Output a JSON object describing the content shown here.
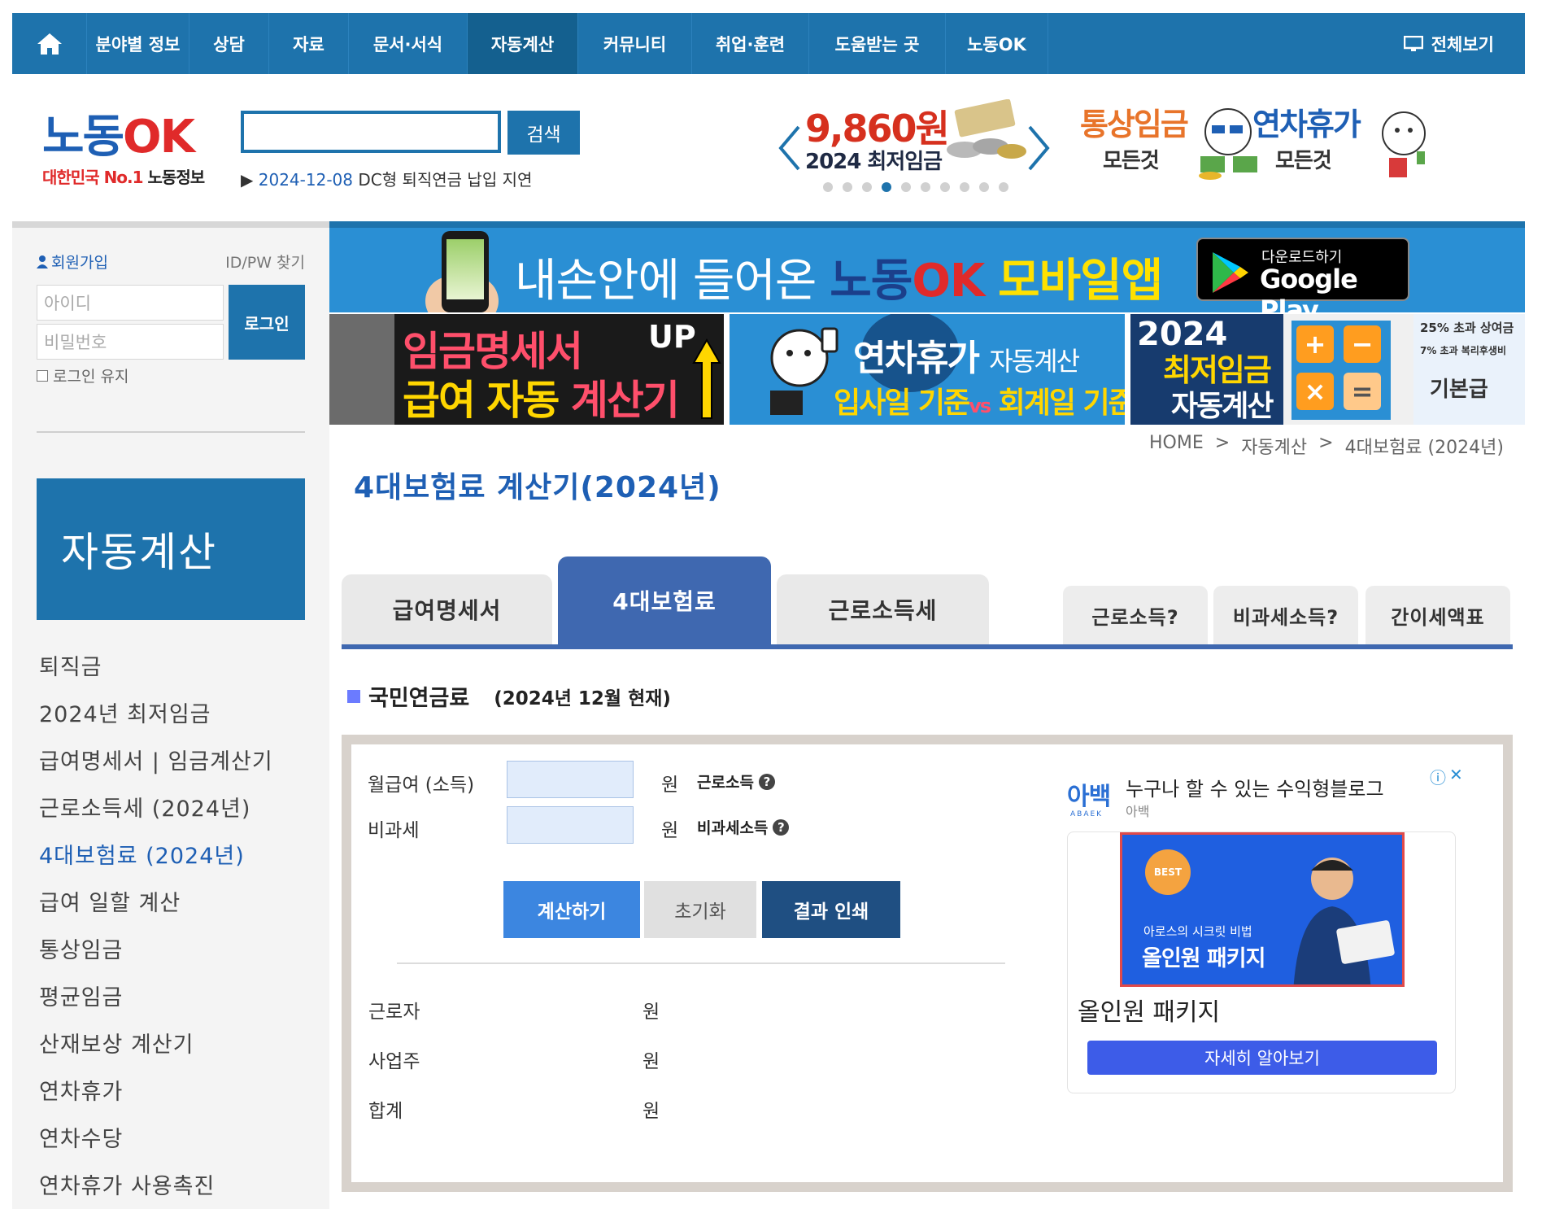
{
  "nav": {
    "items": [
      "분야별 정보",
      "상담",
      "자료",
      "문서·서식",
      "자동계산",
      "커뮤니티",
      "취업·훈련",
      "도움받는 곳",
      "노동OK"
    ],
    "active": "자동계산",
    "fullview": "전체보기"
  },
  "header": {
    "logo_ko": "노동",
    "logo_ok": "OK",
    "logo_tag_red": "대한민국 No.1",
    "logo_tag_black": "노동정보",
    "search_placeholder": "",
    "search_button": "검색",
    "news_date": "2024-12-08",
    "news_text": "DC형 퇴직연금 납입 지연",
    "slider": {
      "title": "9,860원",
      "subtitle": "2024 최저임금",
      "dots": 10,
      "active_dot": 4
    },
    "promo_ordinary": {
      "title": "통상임금",
      "sub": "모든것"
    },
    "promo_leave": {
      "title": "연차휴가",
      "sub": "모든것"
    }
  },
  "sidebar": {
    "join": "회원가입",
    "find": "ID/PW 찾기",
    "id_placeholder": "아이디",
    "pw_placeholder": "비밀번호",
    "login": "로그인",
    "keep": "로그인 유지",
    "banner": "자동계산",
    "menu": [
      "퇴직금",
      "2024년 최저임금",
      "급여명세서 | 임금계산기",
      "근로소득세 (2024년)",
      "4대보험료 (2024년)",
      "급여 일할 계산",
      "통상임금",
      "평균임금",
      "산재보상 계산기",
      "연차휴가",
      "연차수당",
      "연차휴가 사용촉진"
    ],
    "active_index": 4
  },
  "banners": {
    "app": {
      "text1": "내손안에 들어온",
      "text_k": "노동",
      "text_ok": "OK",
      "text_y": "모바일앱",
      "gp_small": "다운로드하기",
      "gp_big": "Google Play"
    },
    "pay": {
      "line1": "임금명세서",
      "line2a": "급여 자동",
      "line2b": "계산기",
      "up": "UP"
    },
    "leave": {
      "line1": "연차휴가",
      "line1_small": "자동계산",
      "line2a": "입사일 기준",
      "vs": "vs",
      "line2b": "회계일 기준"
    },
    "min": {
      "year": "2024",
      "title": "최저임금",
      "auto": "자동계산",
      "p1": "25% 초과 상여금",
      "p2": "7% 초과 복리후생비",
      "p3": "기본급"
    }
  },
  "breadcrumb": [
    "HOME",
    ">",
    "자동계산",
    ">",
    "4대보험료 (2024년)"
  ],
  "page_title": "4대보험료 계산기(2024년)",
  "tabs": {
    "main": [
      "급여명세서",
      "4대보험료",
      "근로소득세"
    ],
    "active": "4대보험료",
    "side": [
      "근로소득?",
      "비과세소득?",
      "간이세액표"
    ]
  },
  "section": {
    "title": "국민연금료",
    "as_of": "(2024년 12월 현재)"
  },
  "form": {
    "salary_label": "월급여 (소득)",
    "salary_value": "",
    "nontax_label": "비과세",
    "nontax_value": "",
    "unit": "원",
    "help1": "근로소득",
    "help2": "비과세소득",
    "calc": "계산하기",
    "reset": "초기화",
    "print": "결과 인쇄"
  },
  "results": [
    {
      "label": "근로자",
      "value": "",
      "unit": "원"
    },
    {
      "label": "사업주",
      "value": "",
      "unit": "원"
    },
    {
      "label": "합계",
      "value": "",
      "unit": "원"
    }
  ],
  "ad": {
    "logo": "아백",
    "logo_sub": "ABAEK",
    "headline": "누구나 할 수 있는 수익형블로그",
    "brand": "아백",
    "badge": "BEST",
    "img_small": "아로스의 시크릿 비법",
    "img_big": "올인원 패키지",
    "title": "올인원 패키지",
    "cta": "자세히 알아보기"
  },
  "colors": {
    "nav": "#1e73ac",
    "tab_active": "#3f68b0",
    "title": "#1e5fb4",
    "calc_button": "#3c86e0",
    "print_button": "#1f4f82"
  }
}
